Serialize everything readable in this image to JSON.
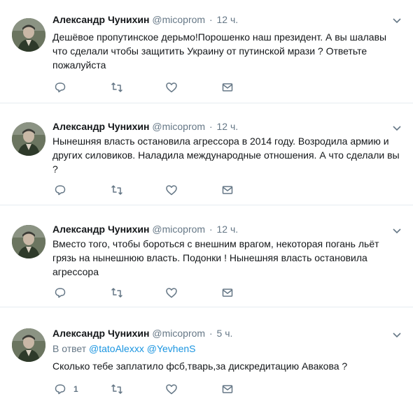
{
  "tweets": [
    {
      "author": "Александр Чунихин",
      "handle": "@micoprom",
      "separator": "·",
      "time": "12 ч.",
      "text": "Дешёвое пропутинское дерьмо!Порошенко наш президент. А вы шалавы что сделали чтобы защитить Украину от путинской мрази ? Ответьте пожалуйста",
      "reply_count": ""
    },
    {
      "author": "Александр Чунихин",
      "handle": "@micoprom",
      "separator": "·",
      "time": "12 ч.",
      "text": "Нынешняя власть остановила агрессора в 2014 году. Возродила армию и других силовиков. Наладила международные отношения. А что сделали вы ?",
      "reply_count": ""
    },
    {
      "author": "Александр Чунихин",
      "handle": "@micoprom",
      "separator": "·",
      "time": "12 ч.",
      "text": "Вместо того, чтобы бороться с внешним врагом, некоторая погань льёт грязь на нынешнюю власть. Подонки ! Нынешняя власть остановила агрессора",
      "reply_count": ""
    },
    {
      "author": "Александр Чунихин",
      "handle": "@micoprom",
      "separator": "·",
      "time": "5 ч.",
      "reply_prefix": "В ответ",
      "reply_mentions": [
        "@tatoAlexxx",
        "@YevhenS"
      ],
      "text": "Сколько тебе заплатило фсб,тварь,за дискредитацию Авакова ?",
      "reply_count": "1"
    }
  ],
  "icons": {
    "reply": "reply-icon",
    "retweet": "retweet-icon",
    "like": "heart-icon",
    "dm": "envelope-icon",
    "caret": "chevron-down-icon"
  },
  "colors": {
    "link": "#1b95e0",
    "muted": "#657786",
    "text": "#14171a",
    "divider": "#e6ecf0"
  }
}
